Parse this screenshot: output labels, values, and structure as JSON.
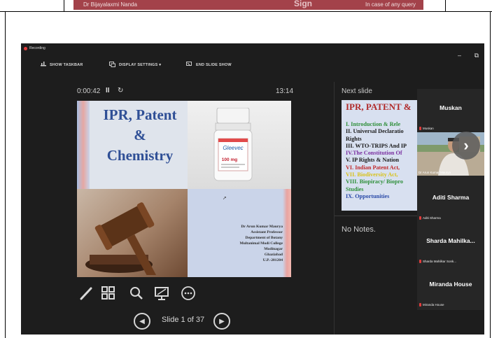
{
  "top_banner": {
    "name": "Dr Bijayalaxmi Nanda",
    "blurred_text": "Sign",
    "query_text": "In case of any query"
  },
  "window": {
    "recording_label": "Recording",
    "minimize_glyph": "–",
    "restore_glyph": "⧉"
  },
  "toolbar": {
    "show_taskbar": "SHOW TASKBAR",
    "display_settings": "DISPLAY SETTINGS ▾",
    "end_slide_show": "END SLIDE SHOW"
  },
  "presenter": {
    "elapsed_time": "0:00:42",
    "pause_glyph": "II",
    "restart_glyph": "↻",
    "clock": "13:14",
    "slide_counter": "Slide 1 of 37"
  },
  "current_slide": {
    "title_lines": [
      "IPR, Patent",
      "&",
      "Chemistry"
    ],
    "bottle_brand": "Gleevec",
    "bottle_dose": "100 mg",
    "author_lines": [
      "Dr Arun Kumar Maurya",
      "Assistant Professor",
      "Department of Botany",
      "Multanimal Modi College",
      "Modinagar",
      "Ghaziabad",
      "U.P.-201204"
    ]
  },
  "next_slide": {
    "label": "Next slide",
    "title": "IPR, PATENT &",
    "items": [
      {
        "text": "I.  Introduction & Rele",
        "color": "#2f8f3a"
      },
      {
        "text": "II. Universal Declaratio",
        "color": "#1a1a1a"
      },
      {
        "text": "     Rights",
        "color": "#1a1a1a"
      },
      {
        "text": "III. WTO-TRIPS And IP",
        "color": "#1a1a1a"
      },
      {
        "text": "IV.The Constitution Of",
        "color": "#7a2fa0"
      },
      {
        "text": "V.  IP Rights & Nation",
        "color": "#1a1a1a"
      },
      {
        "text": "VI. Indian Patent Act,",
        "color": "#c0292b"
      },
      {
        "text": "VII. Biodiversity Act,",
        "color": "#d8c21a"
      },
      {
        "text": "VIII. Biopiracy/ Biopro",
        "color": "#2f8f3a"
      },
      {
        "text": "       Studies",
        "color": "#2f8f3a"
      },
      {
        "text": "IX. Opportunities",
        "color": "#2a4aa8"
      }
    ]
  },
  "notes": {
    "text": "No Notes."
  },
  "participants": [
    {
      "name": "Muskan",
      "label": "Muskan"
    },
    {
      "name": "",
      "label": "Dr Arun Kumar Maurya"
    },
    {
      "name": "Aditi Sharma",
      "label": "Aditi Sharma"
    },
    {
      "name": "Sharda Mahilka...",
      "label": "Sharda Mahilkar Sonk..."
    },
    {
      "name": "Miranda House",
      "label": "Miranda House"
    }
  ],
  "icons": {
    "pen": "pen-icon",
    "slides": "slides-grid-icon",
    "zoom": "magnifier-icon",
    "screen": "screen-icon",
    "more": "more-icon",
    "prev": "chevron-left-icon",
    "next": "chevron-right-icon"
  },
  "colors": {
    "background": "#1d1d1d",
    "banner": "#a3424a",
    "slide_title": "#2f4f96",
    "next_slide_title": "#b02a2a",
    "mic_muted": "#e03c3c"
  }
}
